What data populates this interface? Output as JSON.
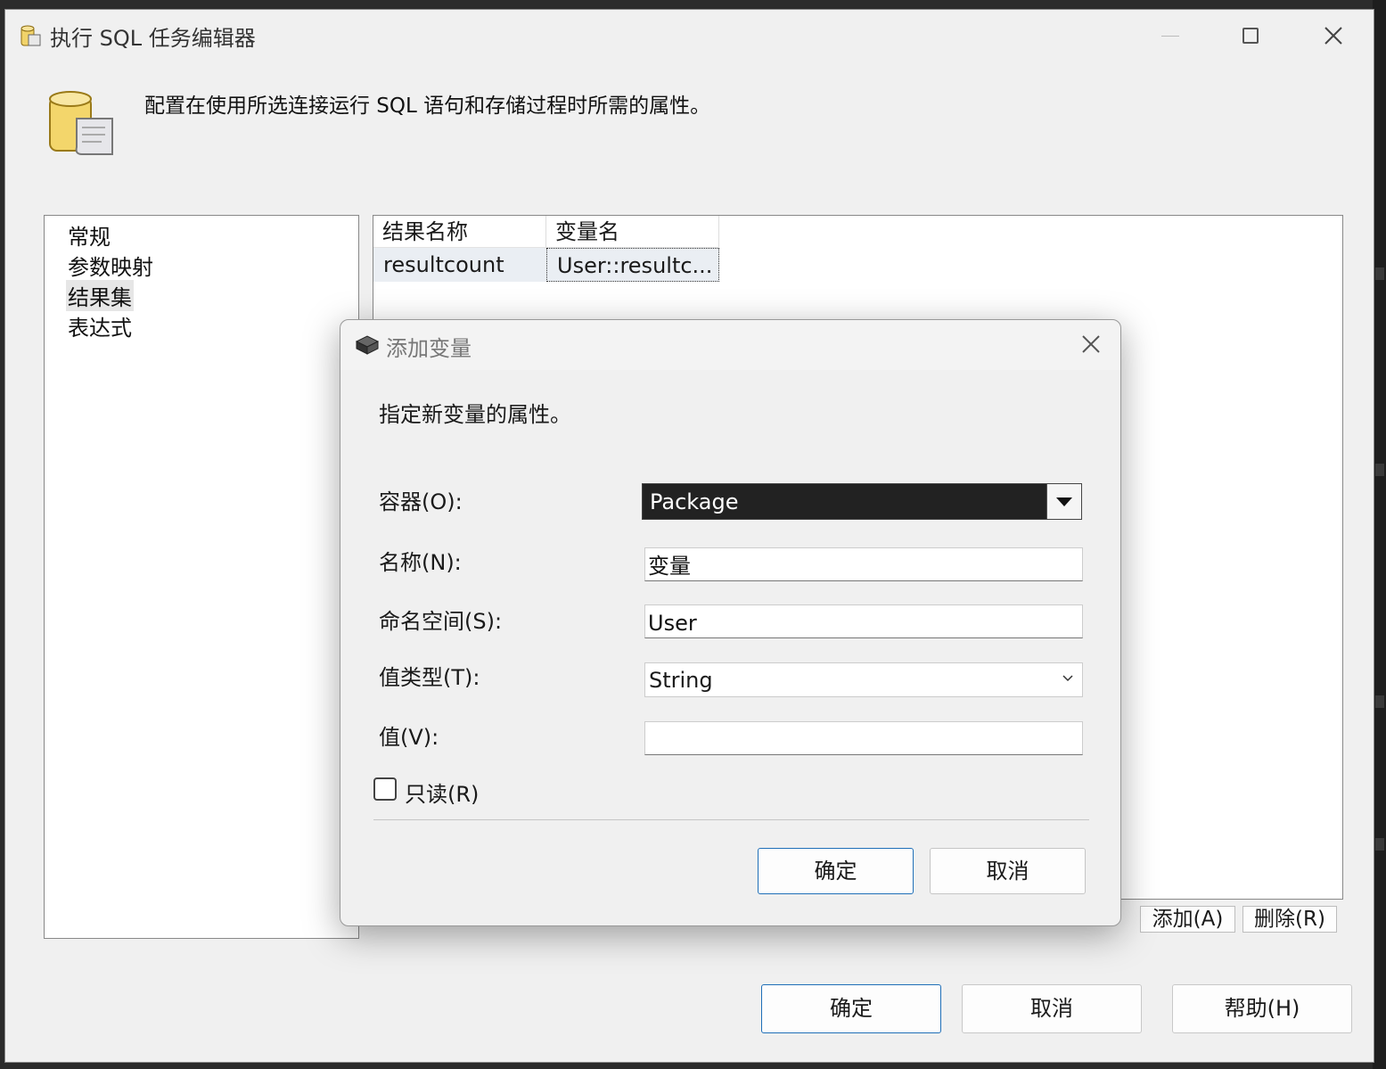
{
  "window": {
    "title": "执行 SQL 任务编辑器",
    "description": "配置在使用所选连接运行 SQL 语句和存储过程时所需的属性。"
  },
  "nav": {
    "items": [
      {
        "label": "常规"
      },
      {
        "label": "参数映射"
      },
      {
        "label": "结果集",
        "selected": true
      },
      {
        "label": "表达式"
      }
    ]
  },
  "result_grid": {
    "columns": [
      "结果名称",
      "变量名"
    ],
    "rows": [
      {
        "result_name": "resultcount",
        "variable_name": "User::resultc..."
      }
    ]
  },
  "grid_buttons": {
    "add": "添加(A)",
    "remove": "删除(R)"
  },
  "footer_buttons": {
    "ok": "确定",
    "cancel": "取消",
    "help": "帮助(H)"
  },
  "dialog": {
    "title": "添加变量",
    "description": "指定新变量的属性。",
    "container_label": "容器(O):",
    "container_value": "Package",
    "name_label": "名称(N):",
    "name_value": "变量",
    "namespace_label": "命名空间(S):",
    "namespace_value": "User",
    "value_type_label": "值类型(T):",
    "value_type_value": "String",
    "value_label": "值(V):",
    "value_value": "",
    "readonly_label": "只读(R)",
    "readonly_checked": false,
    "ok": "确定",
    "cancel": "取消"
  },
  "colors": {
    "primary_border": "#1f6fb8",
    "window_bg": "#f0f0f0",
    "selection_bg": "#eaeef3"
  }
}
